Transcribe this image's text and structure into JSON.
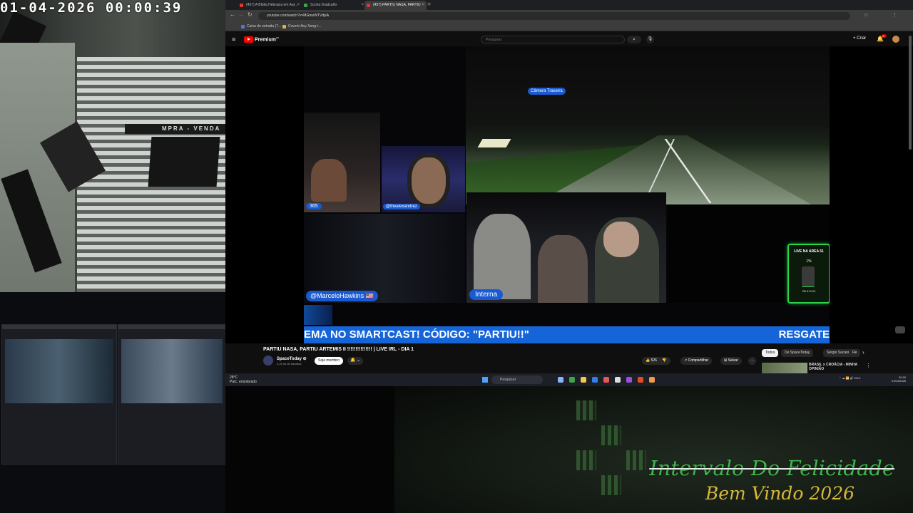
{
  "overlay": {
    "timestamp": "01-04-2026  00:00:39",
    "title": "Intervalo Do Felicidade",
    "subtitle": "Bem Vindo 2026"
  },
  "browser": {
    "tabs": [
      {
        "label": "(457) A Bíblia Hebraica em Aut...",
        "active": false
      },
      {
        "label": "Scorla Dradcaño",
        "active": false
      },
      {
        "label": "(457) PARTIU NASA, PARTIU A...",
        "active": true
      }
    ],
    "url": "youtube.com/watch?v=MGmoWTVdjsA",
    "bookmarks": [
      "Caixa de entrada (7...",
      "Coverir Any Song t..."
    ]
  },
  "youtube": {
    "brand": "Premium",
    "brand_sup": "BR",
    "search_placeholder": "Pesquisar",
    "create_label": "Criar",
    "notif_count": "9+"
  },
  "stream": {
    "rear_camera_label": "Câmera Traseira",
    "labels": {
      "cam365": "365",
      "alex": "@thealexandrez",
      "hawk": "@MarceloHawkins 🇺🇸",
      "internal": "Interna"
    },
    "live51": {
      "title": "LIVE NA AREA 51",
      "percent": "1%",
      "value": "R$ 613,00",
      "progress": 0.01
    },
    "ticker_left": "EMA NO SMARTCAST! CÓDIGO: \"PARTIU!!\"",
    "ticker_right": "RESGATE"
  },
  "video": {
    "title": "PARTIU NASA, PARTIU ARTEMIS II !!!!!!!!!!!!!!! | LIVE IRL - DIA 1",
    "channel": "SpaceToday ⊘",
    "subscribers": "2,24 mi de inscritos",
    "join_label": "Seja membro",
    "likes": "526",
    "share_label": "Compartilhar",
    "save_label": "Salvar",
    "chips": [
      "Todos",
      "De SpaceToday",
      "Sérgio Sacani",
      "Re"
    ],
    "rec_title": "BRASIL x CROÁCIA - MINHA OPINIÃO"
  },
  "taskbar": {
    "weather_temp": "28°C",
    "weather_desc": "Parc. ensolarado",
    "search": "Pesquisar",
    "lang": "ENG",
    "time": "00:00",
    "date": "01/04/2026"
  }
}
